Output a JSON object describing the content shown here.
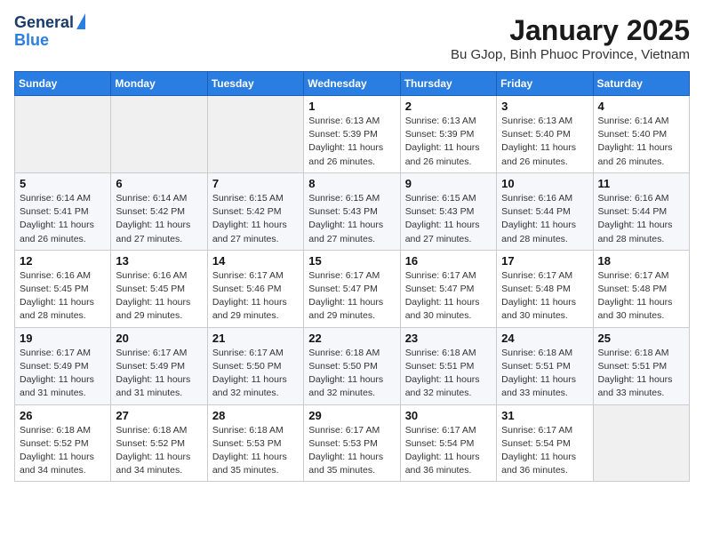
{
  "logo": {
    "line1": "General",
    "line2": "Blue"
  },
  "title": "January 2025",
  "location": "Bu GJop, Binh Phuoc Province, Vietnam",
  "weekdays": [
    "Sunday",
    "Monday",
    "Tuesday",
    "Wednesday",
    "Thursday",
    "Friday",
    "Saturday"
  ],
  "weeks": [
    [
      {
        "day": "",
        "info": ""
      },
      {
        "day": "",
        "info": ""
      },
      {
        "day": "",
        "info": ""
      },
      {
        "day": "1",
        "info": "Sunrise: 6:13 AM\nSunset: 5:39 PM\nDaylight: 11 hours and 26 minutes."
      },
      {
        "day": "2",
        "info": "Sunrise: 6:13 AM\nSunset: 5:39 PM\nDaylight: 11 hours and 26 minutes."
      },
      {
        "day": "3",
        "info": "Sunrise: 6:13 AM\nSunset: 5:40 PM\nDaylight: 11 hours and 26 minutes."
      },
      {
        "day": "4",
        "info": "Sunrise: 6:14 AM\nSunset: 5:40 PM\nDaylight: 11 hours and 26 minutes."
      }
    ],
    [
      {
        "day": "5",
        "info": "Sunrise: 6:14 AM\nSunset: 5:41 PM\nDaylight: 11 hours and 26 minutes."
      },
      {
        "day": "6",
        "info": "Sunrise: 6:14 AM\nSunset: 5:42 PM\nDaylight: 11 hours and 27 minutes."
      },
      {
        "day": "7",
        "info": "Sunrise: 6:15 AM\nSunset: 5:42 PM\nDaylight: 11 hours and 27 minutes."
      },
      {
        "day": "8",
        "info": "Sunrise: 6:15 AM\nSunset: 5:43 PM\nDaylight: 11 hours and 27 minutes."
      },
      {
        "day": "9",
        "info": "Sunrise: 6:15 AM\nSunset: 5:43 PM\nDaylight: 11 hours and 27 minutes."
      },
      {
        "day": "10",
        "info": "Sunrise: 6:16 AM\nSunset: 5:44 PM\nDaylight: 11 hours and 28 minutes."
      },
      {
        "day": "11",
        "info": "Sunrise: 6:16 AM\nSunset: 5:44 PM\nDaylight: 11 hours and 28 minutes."
      }
    ],
    [
      {
        "day": "12",
        "info": "Sunrise: 6:16 AM\nSunset: 5:45 PM\nDaylight: 11 hours and 28 minutes."
      },
      {
        "day": "13",
        "info": "Sunrise: 6:16 AM\nSunset: 5:45 PM\nDaylight: 11 hours and 29 minutes."
      },
      {
        "day": "14",
        "info": "Sunrise: 6:17 AM\nSunset: 5:46 PM\nDaylight: 11 hours and 29 minutes."
      },
      {
        "day": "15",
        "info": "Sunrise: 6:17 AM\nSunset: 5:47 PM\nDaylight: 11 hours and 29 minutes."
      },
      {
        "day": "16",
        "info": "Sunrise: 6:17 AM\nSunset: 5:47 PM\nDaylight: 11 hours and 30 minutes."
      },
      {
        "day": "17",
        "info": "Sunrise: 6:17 AM\nSunset: 5:48 PM\nDaylight: 11 hours and 30 minutes."
      },
      {
        "day": "18",
        "info": "Sunrise: 6:17 AM\nSunset: 5:48 PM\nDaylight: 11 hours and 30 minutes."
      }
    ],
    [
      {
        "day": "19",
        "info": "Sunrise: 6:17 AM\nSunset: 5:49 PM\nDaylight: 11 hours and 31 minutes."
      },
      {
        "day": "20",
        "info": "Sunrise: 6:17 AM\nSunset: 5:49 PM\nDaylight: 11 hours and 31 minutes."
      },
      {
        "day": "21",
        "info": "Sunrise: 6:17 AM\nSunset: 5:50 PM\nDaylight: 11 hours and 32 minutes."
      },
      {
        "day": "22",
        "info": "Sunrise: 6:18 AM\nSunset: 5:50 PM\nDaylight: 11 hours and 32 minutes."
      },
      {
        "day": "23",
        "info": "Sunrise: 6:18 AM\nSunset: 5:51 PM\nDaylight: 11 hours and 32 minutes."
      },
      {
        "day": "24",
        "info": "Sunrise: 6:18 AM\nSunset: 5:51 PM\nDaylight: 11 hours and 33 minutes."
      },
      {
        "day": "25",
        "info": "Sunrise: 6:18 AM\nSunset: 5:51 PM\nDaylight: 11 hours and 33 minutes."
      }
    ],
    [
      {
        "day": "26",
        "info": "Sunrise: 6:18 AM\nSunset: 5:52 PM\nDaylight: 11 hours and 34 minutes."
      },
      {
        "day": "27",
        "info": "Sunrise: 6:18 AM\nSunset: 5:52 PM\nDaylight: 11 hours and 34 minutes."
      },
      {
        "day": "28",
        "info": "Sunrise: 6:18 AM\nSunset: 5:53 PM\nDaylight: 11 hours and 35 minutes."
      },
      {
        "day": "29",
        "info": "Sunrise: 6:17 AM\nSunset: 5:53 PM\nDaylight: 11 hours and 35 minutes."
      },
      {
        "day": "30",
        "info": "Sunrise: 6:17 AM\nSunset: 5:54 PM\nDaylight: 11 hours and 36 minutes."
      },
      {
        "day": "31",
        "info": "Sunrise: 6:17 AM\nSunset: 5:54 PM\nDaylight: 11 hours and 36 minutes."
      },
      {
        "day": "",
        "info": ""
      }
    ]
  ]
}
